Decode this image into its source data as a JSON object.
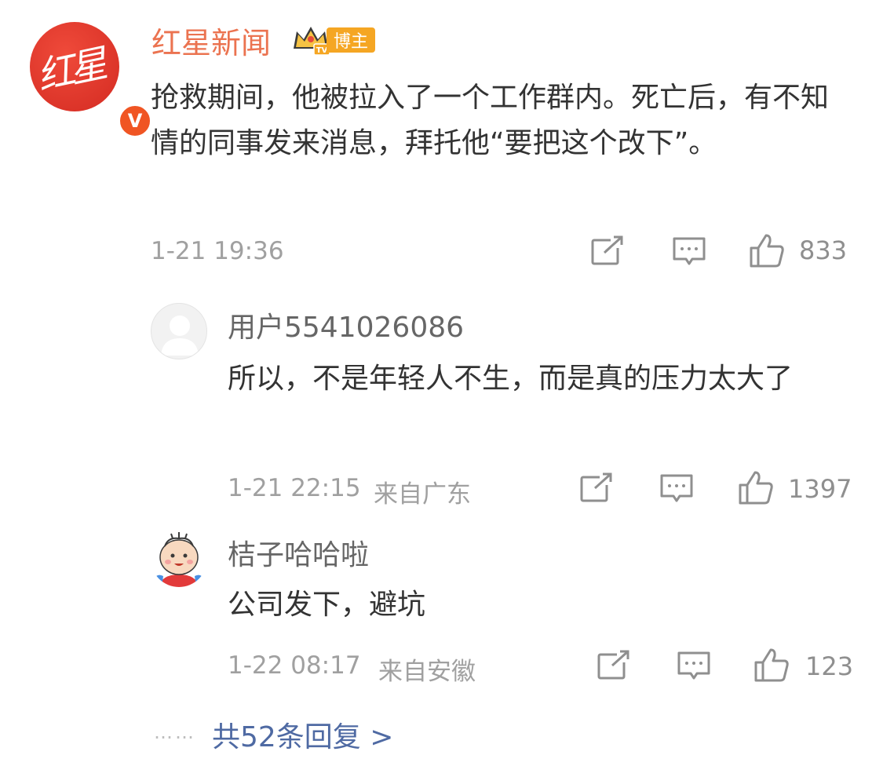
{
  "main": {
    "name": "红星新闻",
    "badge_label": "博主",
    "text": "抢救期间，他被拉入了一个工作群内。死亡后，有不知情的同事发来消息，拜托他“要把这个改下”。",
    "time": "1-21 19:36",
    "likes": "833",
    "icons": [
      "share-icon",
      "comment-icon",
      "like-icon"
    ]
  },
  "replies": [
    {
      "name": "用户5541026086",
      "text": "所以，不是年轻人不生，而是真的压力太大了",
      "time": "1-21 22:15",
      "location": "来自广东",
      "likes": "1397"
    },
    {
      "name": "桔子哈哈啦",
      "text": "公司发下，避坑",
      "time": "1-22 08:17",
      "location": "来自安徽",
      "likes": "123"
    }
  ],
  "footer": {
    "dots": "……",
    "more_label": "共52条回复 >"
  },
  "colors": {
    "accent_name": "#eb7350",
    "link": "#4f6aa3",
    "badge": "#f5a623",
    "vbadge": "#f05523"
  }
}
